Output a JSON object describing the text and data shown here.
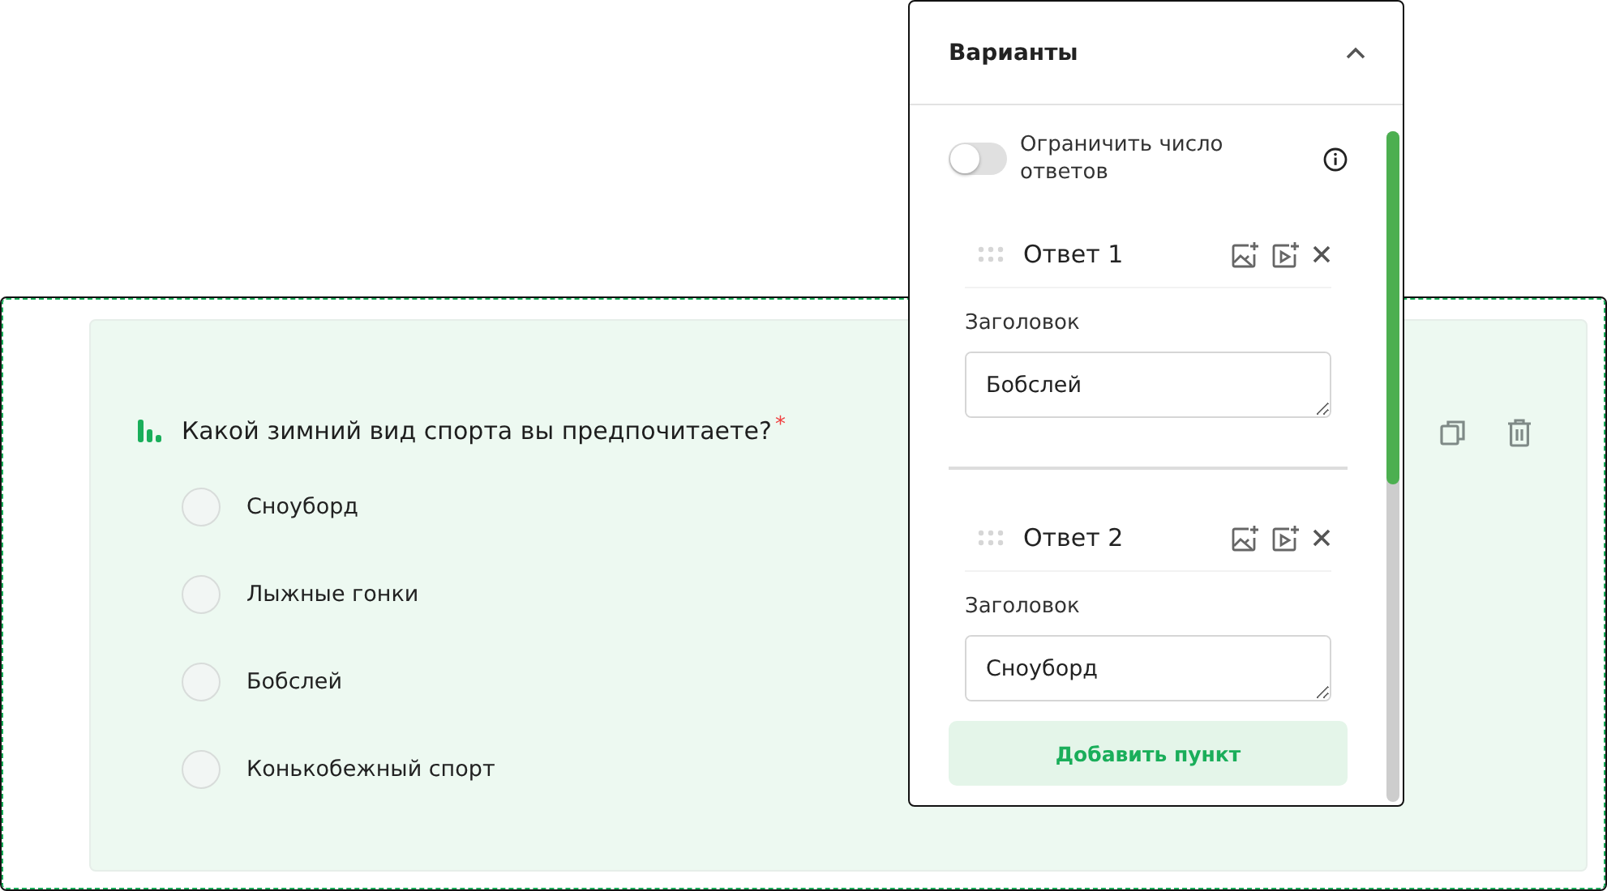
{
  "question": {
    "text": "Какой зимний вид спорта вы предпочитаете?",
    "required_mark": "*",
    "options": [
      {
        "label": "Сноуборд",
        "selected": false
      },
      {
        "label": "Лыжные гонки",
        "selected": false
      },
      {
        "label": "Бобслей",
        "selected": false
      },
      {
        "label": "Конькобежный спорт",
        "selected": false
      }
    ]
  },
  "options_panel": {
    "title": "Варианты",
    "expanded": true,
    "limit_toggle": {
      "label": "Ограничить число ответов",
      "on": false
    },
    "answers": [
      {
        "title": "Ответ 1",
        "field_label": "Заголовок",
        "value": "Бобслей"
      },
      {
        "title": "Ответ 2",
        "field_label": "Заголовок",
        "value": "Сноуборд"
      }
    ],
    "add_button": "Добавить пункт"
  }
}
